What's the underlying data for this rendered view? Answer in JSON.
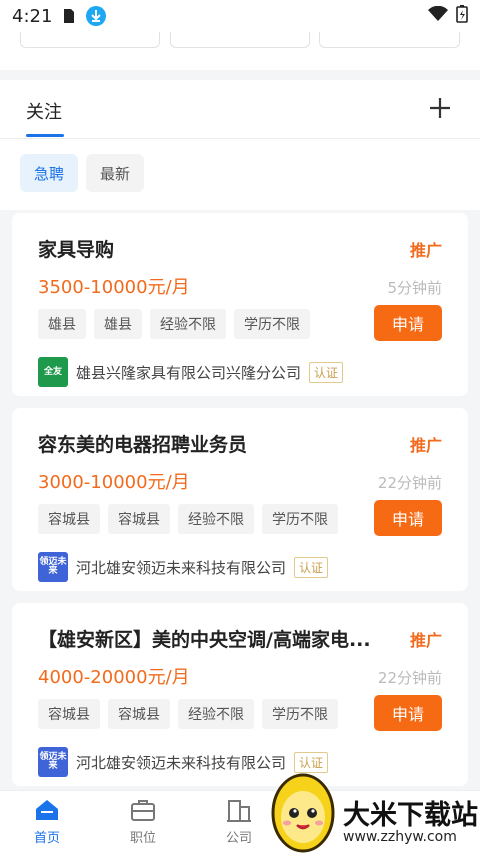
{
  "status_bar": {
    "time": "4:21"
  },
  "follow": {
    "tab_label": "关注",
    "chips": [
      "急聘",
      "最新"
    ]
  },
  "jobs": [
    {
      "title": "家具导购",
      "badge": "推广",
      "salary": "3500-10000元/月",
      "time": "5分钟前",
      "tags": [
        "雄县",
        "雄县",
        "经验不限",
        "学历不限"
      ],
      "apply": "申请",
      "company": "雄县兴隆家具有限公司兴隆分公司",
      "verify": "认证",
      "logo_text": "全友",
      "logo_color": "#1f9a4d"
    },
    {
      "title": "容东美的电器招聘业务员",
      "badge": "推广",
      "salary": "3000-10000元/月",
      "time": "22分钟前",
      "tags": [
        "容城县",
        "容城县",
        "经验不限",
        "学历不限"
      ],
      "apply": "申请",
      "company": "河北雄安领迈未来科技有限公司",
      "verify": "认证",
      "logo_text": "领迈未来",
      "logo_color": "#3f64d8"
    },
    {
      "title": "【雄安新区】美的中央空调/高端家电...",
      "badge": "推广",
      "salary": "4000-20000元/月",
      "time": "22分钟前",
      "tags": [
        "容城县",
        "容城县",
        "经验不限",
        "学历不限"
      ],
      "apply": "申请",
      "company": "河北雄安领迈未来科技有限公司",
      "verify": "认证",
      "logo_text": "领迈未来",
      "logo_color": "#3f64d8"
    }
  ],
  "nav": {
    "home": "首页",
    "jobs": "职位",
    "company": "公司"
  },
  "watermark": {
    "text": "大米下载站",
    "url": "www.zzhyw.com"
  },
  "colors": {
    "accent": "#1a73e8",
    "orange": "#f26b1d",
    "apply_bg": "#f76a14"
  }
}
